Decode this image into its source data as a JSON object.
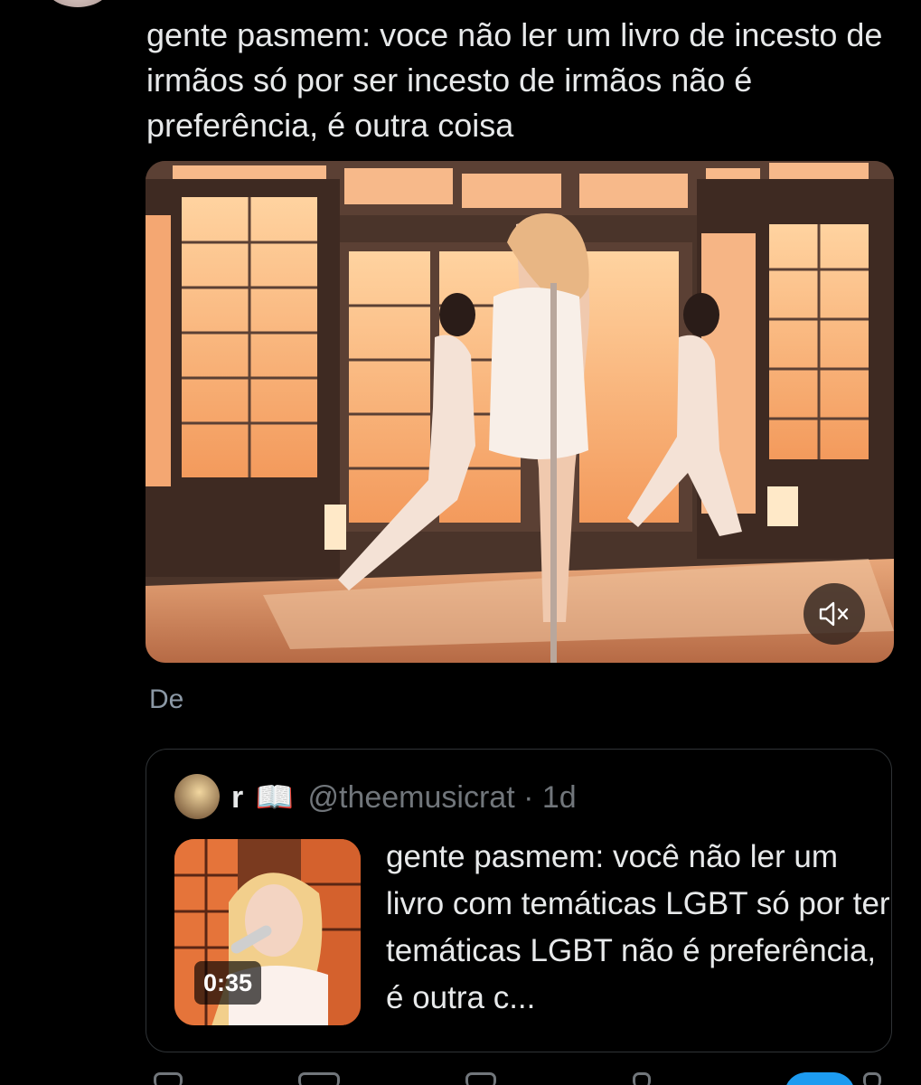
{
  "tweet": {
    "text": "gente pasmem: voce não ler um livro de incesto de irmãos só por ser incesto de irmãos não é preferência, é outra coisa",
    "translate_label": "De"
  },
  "media": {
    "type": "video",
    "mute_icon": "speaker-muted-icon"
  },
  "quoted_tweet": {
    "name": "r",
    "name_emoji": "📖",
    "handle": "@theemusicrat",
    "separator": "·",
    "time": "1d",
    "text": "gente pasmem: você não ler um livro com temáticas LGBT só por ter temáticas LGBT não é preferência, é outra c...",
    "video_duration": "0:35"
  },
  "colors": {
    "background": "#000000",
    "text": "#e7e9ea",
    "muted": "#71767b",
    "border": "#2f3336",
    "accent": "#1d9bf0"
  }
}
